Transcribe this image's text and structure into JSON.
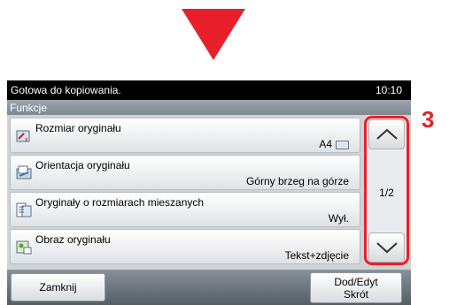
{
  "callout_number": "3",
  "status": {
    "message": "Gotowa do kopiowania.",
    "time": "10:10"
  },
  "function_bar": {
    "label": "Funkcje"
  },
  "items": [
    {
      "label": "Rozmiar oryginału",
      "value": "A4",
      "icon": "original-size-icon"
    },
    {
      "label": "Orientacja oryginału",
      "value": "Górny brzeg na górze",
      "icon": "orientation-icon"
    },
    {
      "label": "Oryginały o rozmiarach mieszanych",
      "value": "Wył.",
      "icon": "mixed-size-icon"
    },
    {
      "label": "Obraz oryginału",
      "value": "Tekst+zdjęcie",
      "icon": "original-image-icon"
    }
  ],
  "pager": {
    "text": "1/2"
  },
  "footer": {
    "close_label": "Zamknij",
    "add_label_line1": "Dod/Edyt",
    "add_label_line2": "Skrót"
  },
  "colors": {
    "accent": "#e8202a",
    "status_bar": "#000000",
    "panel": "#cfd3d6"
  }
}
